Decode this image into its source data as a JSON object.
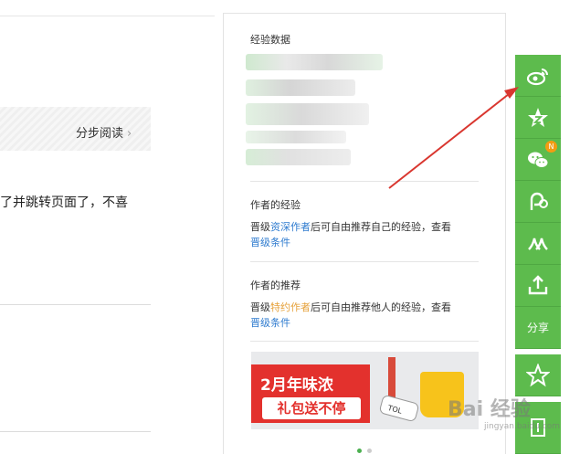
{
  "left": {
    "step_read_label": "分步阅读",
    "step_read_chevron": "›",
    "article_fragment": "了并跳转页面了，不喜"
  },
  "panel": {
    "stats_title": "经验数据",
    "author_exp_title": "作者的经验",
    "author_exp_desc": {
      "prefix": "晋级",
      "highlight": "资深作者",
      "suffix": "后可自由推荐自己的经验，查看",
      "link": "晋级条件"
    },
    "author_rec_title": "作者的推荐",
    "author_rec_desc": {
      "prefix": "晋级",
      "highlight": "特约作者",
      "suffix": "后可自由推荐他人的经验，查看",
      "link": "晋级条件"
    },
    "banner": {
      "line1": "2月年味浓",
      "line2": "礼包送不停"
    }
  },
  "share_bar": {
    "items": [
      {
        "icon": "weibo-icon",
        "color": "#5dbb4d"
      },
      {
        "icon": "qzone-star-icon",
        "color": "#5dbb4d"
      },
      {
        "icon": "wechat-icon",
        "color": "#5dbb4d",
        "badge": "N"
      },
      {
        "icon": "tieba-icon",
        "color": "#5dbb4d"
      },
      {
        "icon": "renren-icon",
        "color": "#5dbb4d"
      },
      {
        "icon": "share-upload-icon",
        "color": "#5dbb4d"
      }
    ],
    "share_label": "分享",
    "favorite_icon": "star-outline-icon",
    "bottom_icon": "bookmark-icon"
  },
  "watermark": {
    "text": "Bai 经验",
    "sub": "jingyan.baidu.com"
  },
  "colors": {
    "share_green": "#5dbb4d",
    "link_blue": "#2e7bcf",
    "highlight_orange": "#e6a23c",
    "arrow_red": "#d9362f"
  }
}
